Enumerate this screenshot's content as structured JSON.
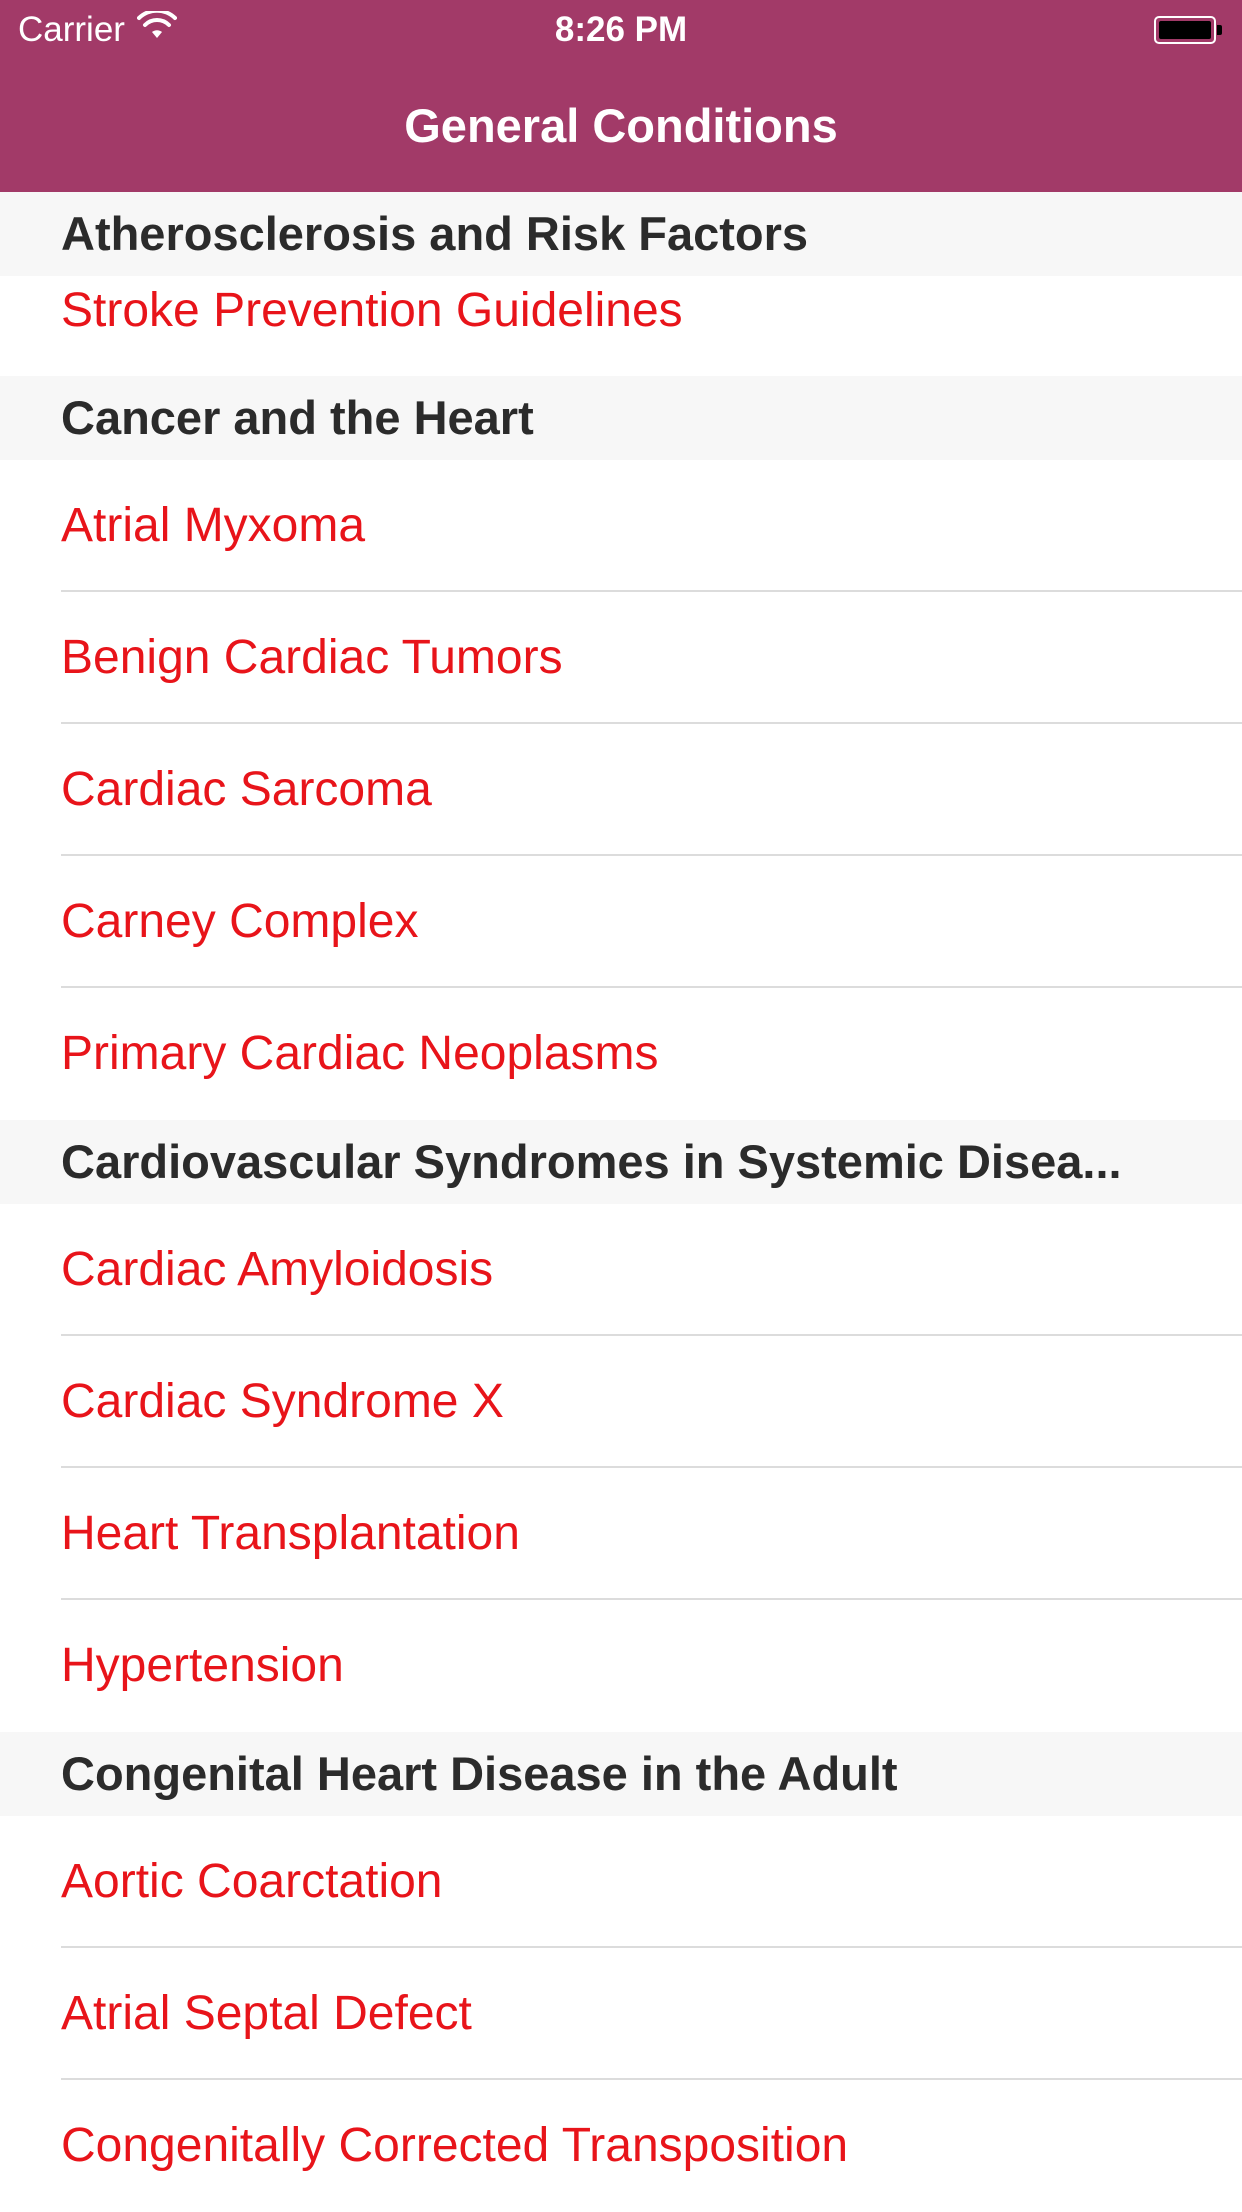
{
  "status_bar": {
    "carrier": "Carrier",
    "time": "8:26 PM"
  },
  "nav": {
    "title": "General Conditions",
    "color": "#a23a68"
  },
  "accent_color": "#e8141a",
  "sections": [
    {
      "header": "Atherosclerosis and Risk Factors",
      "items": [
        "Stroke Prevention Guidelines"
      ]
    },
    {
      "header": "Cancer and the Heart",
      "items": [
        "Atrial Myxoma",
        "Benign Cardiac Tumors",
        "Cardiac Sarcoma",
        "Carney Complex",
        "Primary Cardiac Neoplasms"
      ]
    },
    {
      "header": "Cardiovascular Syndromes in Systemic Disea...",
      "items": [
        "Cardiac Amyloidosis",
        "Cardiac Syndrome X",
        "Heart Transplantation",
        "Hypertension"
      ]
    },
    {
      "header": "Congenital Heart Disease in the Adult",
      "items": [
        "Aortic Coarctation",
        "Atrial Septal Defect",
        "Congenitally Corrected Transposition"
      ]
    }
  ]
}
